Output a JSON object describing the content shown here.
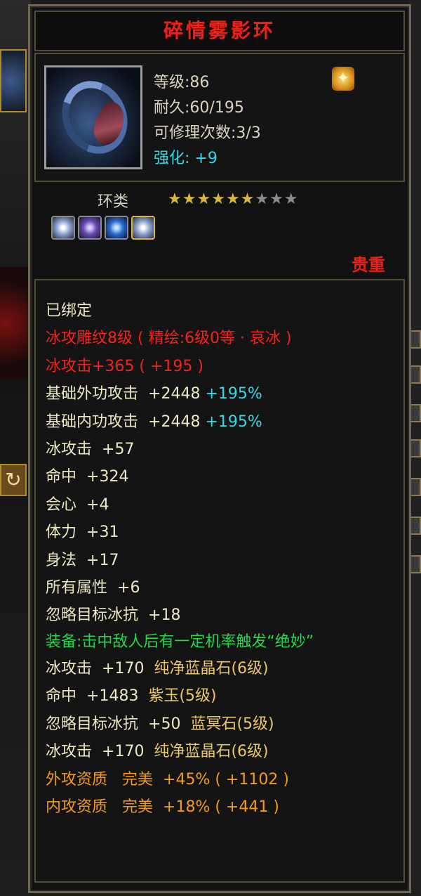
{
  "item": {
    "name": "碎情雾影环",
    "level": "等级:86",
    "durability": "耐久:60/195",
    "repairs": "可修理次数:3/3",
    "enhance_label": "强化:",
    "enhance_value": "+9",
    "type": "环类",
    "stars_filled": 6,
    "stars_total": 9,
    "rarity": "贵重"
  },
  "attributes": {
    "bound": "已绑定",
    "engrave": "冰攻雕纹8级 ( 精绘:6级0等 · 哀冰 )",
    "ice_attack": "冰攻击+365 ( +195 )",
    "base_ext": {
      "label": "基础外功攻击",
      "value": "+2448",
      "pct": "+195%"
    },
    "base_int": {
      "label": "基础内功攻击",
      "value": "+2448",
      "pct": "+195%"
    },
    "stats": [
      {
        "label": "冰攻击",
        "value": "+57"
      },
      {
        "label": "命中",
        "value": "+324"
      },
      {
        "label": "会心",
        "value": "+4"
      },
      {
        "label": "体力",
        "value": "+31"
      },
      {
        "label": "身法",
        "value": "+17"
      },
      {
        "label": "所有属性",
        "value": "+6"
      },
      {
        "label": "忽略目标冰抗",
        "value": "+18"
      }
    ],
    "equip_effect": "装备:击中敌人后有一定机率触发“绝妙”",
    "gems": [
      {
        "stat": "冰攻击",
        "value": "+170",
        "gem": "纯净蓝晶石(6级)"
      },
      {
        "stat": "命中",
        "value": "+1483",
        "gem": "紫玉(5级)"
      },
      {
        "stat": "忽略目标冰抗",
        "value": "+50",
        "gem": "蓝冥石(5级)"
      },
      {
        "stat": "冰攻击",
        "value": "+170",
        "gem": "纯净蓝晶石(6级)"
      }
    ],
    "aptitude": [
      {
        "label": "外攻资质",
        "grade": "完美",
        "value": "+45% ( +1102 )"
      },
      {
        "label": "内攻资质",
        "grade": "完美",
        "value": "+18% ( +441 )"
      }
    ]
  },
  "colors": {
    "title": "#e8221a",
    "cyan": "#35d8e6",
    "green": "#26d64a",
    "orange": "#f39a1c",
    "star": "#d8b640"
  }
}
